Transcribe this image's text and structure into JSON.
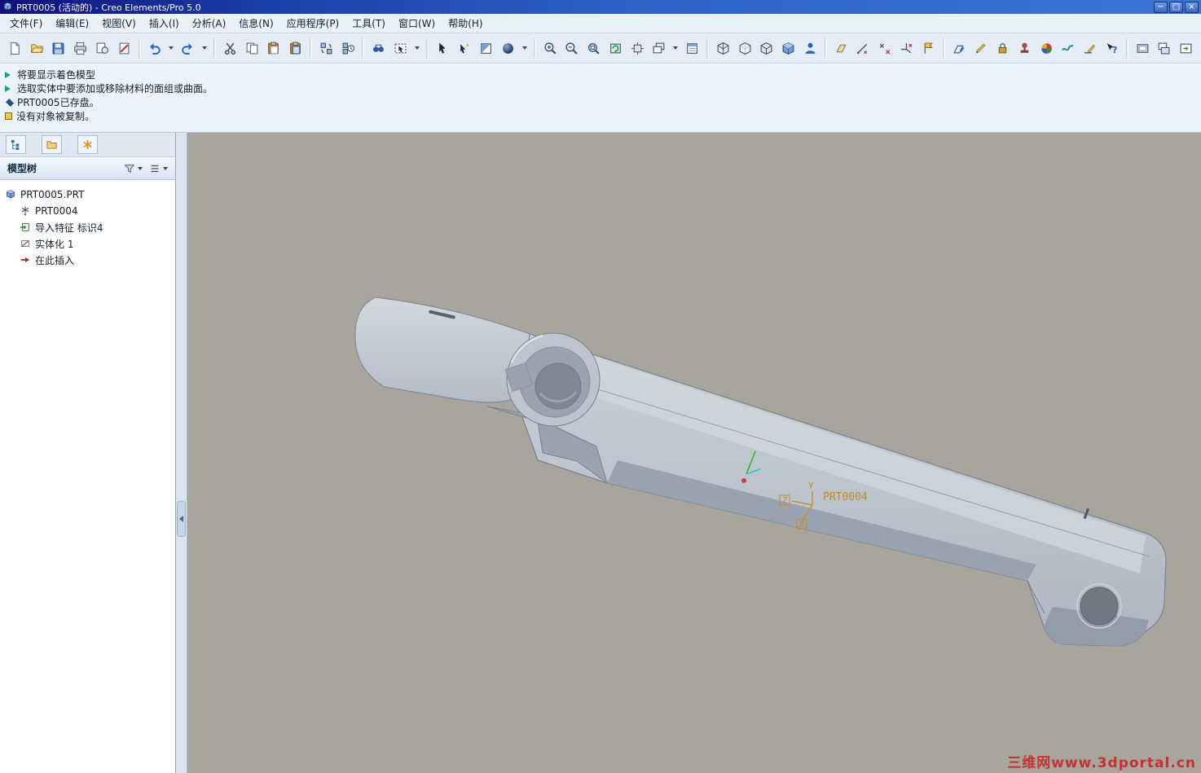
{
  "window": {
    "title": "PRT0005 (活动的) - Creo Elements/Pro 5.0",
    "controls": [
      {
        "name": "minimize-button",
        "glyph": "−"
      },
      {
        "name": "maximize-button",
        "glyph": "□"
      },
      {
        "name": "close-button",
        "glyph": "×"
      }
    ]
  },
  "menu": {
    "items": [
      {
        "id": "file",
        "label": "文件(F)"
      },
      {
        "id": "edit",
        "label": "编辑(E)"
      },
      {
        "id": "view",
        "label": "视图(V)"
      },
      {
        "id": "insert",
        "label": "插入(I)"
      },
      {
        "id": "analysis",
        "label": "分析(A)"
      },
      {
        "id": "info",
        "label": "信息(N)"
      },
      {
        "id": "applications",
        "label": "应用程序(P)"
      },
      {
        "id": "tools",
        "label": "工具(T)"
      },
      {
        "id": "window",
        "label": "窗口(W)"
      },
      {
        "id": "help",
        "label": "帮助(H)"
      }
    ]
  },
  "toolbar": {
    "groups": [
      {
        "buttons": [
          {
            "name": "new-file-button",
            "icon": "new-file-icon"
          },
          {
            "name": "open-button",
            "icon": "open-icon"
          },
          {
            "name": "save-button",
            "icon": "save-icon"
          },
          {
            "name": "print-button",
            "icon": "print-icon"
          },
          {
            "name": "print-preview-button",
            "icon": "print-preview-icon"
          },
          {
            "name": "erase-display-button",
            "icon": "erase-display-icon"
          }
        ]
      },
      {
        "buttons": [
          {
            "name": "undo-button",
            "icon": "undo-icon"
          },
          {
            "name": "undo-dropdown",
            "type": "dropdown"
          },
          {
            "name": "redo-button",
            "icon": "redo-icon"
          },
          {
            "name": "redo-dropdown",
            "type": "dropdown"
          }
        ]
      },
      {
        "buttons": [
          {
            "name": "cut-button",
            "icon": "cut-icon"
          },
          {
            "name": "copy-button",
            "icon": "copy-icon"
          },
          {
            "name": "paste-button",
            "icon": "paste-icon"
          },
          {
            "name": "paste-special-button",
            "icon": "paste-special-icon"
          }
        ]
      },
      {
        "buttons": [
          {
            "name": "regenerate-button",
            "icon": "regenerate-icon"
          },
          {
            "name": "regen-manager-button",
            "icon": "regen-manager-icon"
          }
        ]
      },
      {
        "buttons": [
          {
            "name": "find-button",
            "icon": "find-icon"
          },
          {
            "name": "selection-filter-button",
            "icon": "selection-filter-icon"
          },
          {
            "name": "selection-filter-dropdown",
            "type": "dropdown"
          }
        ]
      },
      {
        "buttons": [
          {
            "name": "select-items-button",
            "icon": "select-items-icon"
          },
          {
            "name": "smart-select-button",
            "icon": "smart-select-icon"
          },
          {
            "name": "shade-tool-button",
            "icon": "shade-tool-icon"
          },
          {
            "name": "appearance-sphere-button",
            "icon": "appearance-sphere-icon"
          },
          {
            "name": "appearance-dropdown",
            "type": "dropdown"
          }
        ]
      },
      {
        "buttons": [
          {
            "name": "zoom-in-button",
            "icon": "zoom-in-icon"
          },
          {
            "name": "zoom-out-button",
            "icon": "zoom-out-icon"
          },
          {
            "name": "refit-button",
            "icon": "refit-icon"
          },
          {
            "name": "repaint-button",
            "icon": "repaint-icon"
          },
          {
            "name": "orient-button",
            "icon": "orient-icon"
          },
          {
            "name": "saved-views-button",
            "icon": "saved-views-icon"
          },
          {
            "name": "saved-views-dropdown",
            "type": "dropdown"
          },
          {
            "name": "view-manager-button",
            "icon": "view-manager-icon"
          }
        ]
      },
      {
        "buttons": [
          {
            "name": "wireframe-button",
            "icon": "wireframe-icon"
          },
          {
            "name": "hidden-line-button",
            "icon": "hidden-line-icon"
          },
          {
            "name": "no-hidden-button",
            "icon": "no-hidden-icon"
          },
          {
            "name": "shaded-button",
            "icon": "shaded-icon"
          },
          {
            "name": "person-button",
            "icon": "person-icon"
          }
        ]
      },
      {
        "buttons": [
          {
            "name": "datum-planes-toggle",
            "icon": "datum-planes-icon"
          },
          {
            "name": "datum-axes-toggle",
            "icon": "datum-axes-icon"
          },
          {
            "name": "datum-points-toggle",
            "icon": "datum-points-icon"
          },
          {
            "name": "datum-csys-toggle",
            "icon": "datum-csys-icon"
          },
          {
            "name": "annotations-toggle",
            "icon": "annotations-icon"
          }
        ]
      },
      {
        "buttons": [
          {
            "name": "datum-plane-tool-button",
            "icon": "datum-plane-tool-icon"
          },
          {
            "name": "sketch-tool-button",
            "icon": "sketch-tool-icon"
          },
          {
            "name": "lock-tool-button",
            "icon": "lock-tool-icon"
          },
          {
            "name": "stamp-tool-button",
            "icon": "stamp-tool-icon"
          },
          {
            "name": "appearance-gallery-button",
            "icon": "appearance-gallery-icon"
          },
          {
            "name": "style-tool-button",
            "icon": "style-tool-icon"
          },
          {
            "name": "annotation-tool-button",
            "icon": "annotation-tool-icon"
          },
          {
            "name": "context-help-button",
            "icon": "context-help-icon"
          }
        ]
      },
      {
        "buttons": [
          {
            "name": "window-fit-button",
            "icon": "window-fit-icon"
          },
          {
            "name": "window-activate-button",
            "icon": "window-activate-icon"
          },
          {
            "name": "window-extra-button",
            "icon": "window-extra-icon"
          }
        ]
      }
    ]
  },
  "messages": [
    {
      "icon": "arrow",
      "text": "将要显示着色模型"
    },
    {
      "icon": "arrow",
      "text": "选取实体中要添加或移除材料的面组或曲面。"
    },
    {
      "icon": "bullet",
      "text": "PRT0005已存盘。"
    },
    {
      "icon": "info",
      "text": "没有对象被复制。"
    }
  ],
  "panel": {
    "tabs": [
      {
        "name": "model-tree-tab",
        "icon": "model-tree-tab-icon"
      },
      {
        "name": "folder-browser-tab",
        "icon": "folder-tab-icon"
      },
      {
        "name": "favorites-tab",
        "icon": "settings-tab-icon"
      }
    ]
  },
  "model_tree": {
    "title": "模型树",
    "items": [
      {
        "name": "tree-node-prt0005",
        "icon": "part-icon",
        "label": "PRT0005.PRT",
        "indent": 0
      },
      {
        "name": "tree-node-prt0004",
        "icon": "feature-csys-icon",
        "label": "PRT0004",
        "indent": 1
      },
      {
        "name": "tree-node-import-feature",
        "icon": "feature-import-icon",
        "label": "导入特征 标识4",
        "indent": 1
      },
      {
        "name": "tree-node-solidify",
        "icon": "feature-solidify-icon",
        "label": "实体化 1",
        "indent": 1
      },
      {
        "name": "tree-node-insert-here",
        "icon": "insert-here-icon",
        "label": "在此插入",
        "indent": 1
      }
    ]
  },
  "viewport": {
    "csys": {
      "label": "PRT0004",
      "axis_x": "X",
      "axis_y": "Y",
      "axis_z": "Z"
    },
    "watermark": "三维网www.3dportal.cn",
    "colors": {
      "background": "#a9a59c",
      "csys": "#c9882a",
      "watermark": "#c62828",
      "model": "#bdc5ce"
    }
  }
}
